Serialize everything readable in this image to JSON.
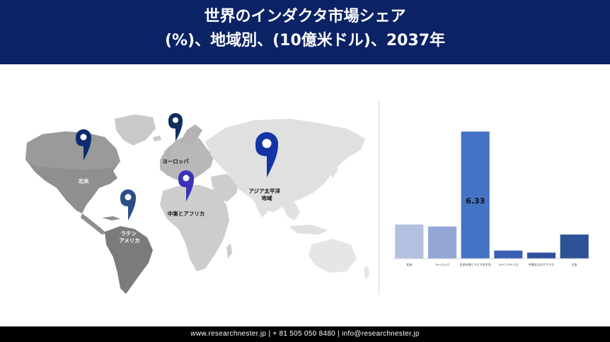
{
  "header": {
    "title_line1": "世界のインダクタ市場シェア",
    "title_line2": "(%)、地域別、(10億米ドル)、2037年"
  },
  "map": {
    "regions": [
      {
        "key": "north-america",
        "label": "北米",
        "color": "#0d2a6e"
      },
      {
        "key": "europe",
        "label": "ヨーロッパ",
        "color": "#0f2f60"
      },
      {
        "key": "asia-pacific",
        "label": "アジア太平洋\n地域",
        "color": "#1333a6"
      },
      {
        "key": "middle-east-africa",
        "label": "中東とアフリカ",
        "color": "#3a33b8"
      },
      {
        "key": "latin-america",
        "label": "ラテン\nアメリカ",
        "color": "#2a4e86"
      }
    ]
  },
  "chart_data": {
    "type": "bar",
    "categories": [
      "北米",
      "ヨーロッパ",
      "日本を除くアジア太平洋",
      "ラテンアメリカ",
      "中東およびアフリカ",
      "日本"
    ],
    "values": [
      1.7,
      1.6,
      6.33,
      0.4,
      0.3,
      1.2
    ],
    "data_labels": [
      "",
      "",
      "6.33",
      "",
      "",
      ""
    ],
    "colors": [
      "#b4c0df",
      "#93a6d6",
      "#4472c4",
      "#3a60b5",
      "#2f50a0",
      "#2e5296"
    ],
    "ylim": [
      0,
      6.9
    ],
    "title": "",
    "xlabel": "",
    "ylabel": ""
  },
  "footer": {
    "text": "www.researchnester.jp | + 81 505 050 8480 | info@researchnester.jp"
  }
}
